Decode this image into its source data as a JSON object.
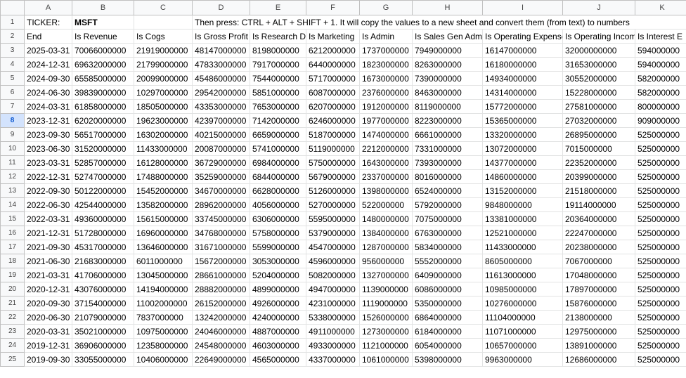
{
  "columns": [
    "A",
    "B",
    "C",
    "D",
    "E",
    "F",
    "G",
    "H",
    "I",
    "J",
    "K"
  ],
  "active_row": "8",
  "row1": {
    "ticker_label": "TICKER:",
    "ticker_value": "MSFT",
    "instruction": "Then press: CTRL + ALT + SHIFT + 1. It will copy the values to a new sheet and convert them (from text) to numbers"
  },
  "headers": [
    "End",
    "Is Revenue",
    "Is Cogs",
    "Is Gross Profit",
    "Is Research De",
    "Is Marketing",
    "Is Admin",
    "Is Sales Gen Admi",
    "Is Operating Expense",
    "Is Operating Incom",
    "Is Interest E"
  ],
  "rows": [
    [
      "3",
      "2025-03-31",
      "70066000000",
      "21919000000",
      "48147000000",
      "8198000000",
      "6212000000",
      "1737000000",
      "7949000000",
      "16147000000",
      "32000000000",
      "594000000"
    ],
    [
      "4",
      "2024-12-31",
      "69632000000",
      "21799000000",
      "47833000000",
      "7917000000",
      "6440000000",
      "1823000000",
      "8263000000",
      "16180000000",
      "31653000000",
      "594000000"
    ],
    [
      "5",
      "2024-09-30",
      "65585000000",
      "20099000000",
      "45486000000",
      "7544000000",
      "5717000000",
      "1673000000",
      "7390000000",
      "14934000000",
      "30552000000",
      "582000000"
    ],
    [
      "6",
      "2024-06-30",
      "39839000000",
      "10297000000",
      "29542000000",
      "5851000000",
      "6087000000",
      "2376000000",
      "8463000000",
      "14314000000",
      "15228000000",
      "582000000"
    ],
    [
      "7",
      "2024-03-31",
      "61858000000",
      "18505000000",
      "43353000000",
      "7653000000",
      "6207000000",
      "1912000000",
      "8119000000",
      "15772000000",
      "27581000000",
      "800000000"
    ],
    [
      "8",
      "2023-12-31",
      "62020000000",
      "19623000000",
      "42397000000",
      "7142000000",
      "6246000000",
      "1977000000",
      "8223000000",
      "15365000000",
      "27032000000",
      "909000000"
    ],
    [
      "9",
      "2023-09-30",
      "56517000000",
      "16302000000",
      "40215000000",
      "6659000000",
      "5187000000",
      "1474000000",
      "6661000000",
      "13320000000",
      "26895000000",
      "525000000"
    ],
    [
      "10",
      "2023-06-30",
      "31520000000",
      "11433000000",
      "20087000000",
      "5741000000",
      "5119000000",
      "2212000000",
      "7331000000",
      "13072000000",
      "7015000000",
      "525000000"
    ],
    [
      "11",
      "2023-03-31",
      "52857000000",
      "16128000000",
      "36729000000",
      "6984000000",
      "5750000000",
      "1643000000",
      "7393000000",
      "14377000000",
      "22352000000",
      "525000000"
    ],
    [
      "12",
      "2022-12-31",
      "52747000000",
      "17488000000",
      "35259000000",
      "6844000000",
      "5679000000",
      "2337000000",
      "8016000000",
      "14860000000",
      "20399000000",
      "525000000"
    ],
    [
      "13",
      "2022-09-30",
      "50122000000",
      "15452000000",
      "34670000000",
      "6628000000",
      "5126000000",
      "1398000000",
      "6524000000",
      "13152000000",
      "21518000000",
      "525000000"
    ],
    [
      "14",
      "2022-06-30",
      "42544000000",
      "13582000000",
      "28962000000",
      "4056000000",
      "5270000000",
      "522000000",
      "5792000000",
      "9848000000",
      "19114000000",
      "525000000"
    ],
    [
      "15",
      "2022-03-31",
      "49360000000",
      "15615000000",
      "33745000000",
      "6306000000",
      "5595000000",
      "1480000000",
      "7075000000",
      "13381000000",
      "20364000000",
      "525000000"
    ],
    [
      "16",
      "2021-12-31",
      "51728000000",
      "16960000000",
      "34768000000",
      "5758000000",
      "5379000000",
      "1384000000",
      "6763000000",
      "12521000000",
      "22247000000",
      "525000000"
    ],
    [
      "17",
      "2021-09-30",
      "45317000000",
      "13646000000",
      "31671000000",
      "5599000000",
      "4547000000",
      "1287000000",
      "5834000000",
      "11433000000",
      "20238000000",
      "525000000"
    ],
    [
      "18",
      "2021-06-30",
      "21683000000",
      "6011000000",
      "15672000000",
      "3053000000",
      "4596000000",
      "956000000",
      "5552000000",
      "8605000000",
      "7067000000",
      "525000000"
    ],
    [
      "19",
      "2021-03-31",
      "41706000000",
      "13045000000",
      "28661000000",
      "5204000000",
      "5082000000",
      "1327000000",
      "6409000000",
      "11613000000",
      "17048000000",
      "525000000"
    ],
    [
      "20",
      "2020-12-31",
      "43076000000",
      "14194000000",
      "28882000000",
      "4899000000",
      "4947000000",
      "1139000000",
      "6086000000",
      "10985000000",
      "17897000000",
      "525000000"
    ],
    [
      "21",
      "2020-09-30",
      "37154000000",
      "11002000000",
      "26152000000",
      "4926000000",
      "4231000000",
      "1119000000",
      "5350000000",
      "10276000000",
      "15876000000",
      "525000000"
    ],
    [
      "22",
      "2020-06-30",
      "21079000000",
      "7837000000",
      "13242000000",
      "4240000000",
      "5338000000",
      "1526000000",
      "6864000000",
      "11104000000",
      "2138000000",
      "525000000"
    ],
    [
      "23",
      "2020-03-31",
      "35021000000",
      "10975000000",
      "24046000000",
      "4887000000",
      "4911000000",
      "1273000000",
      "6184000000",
      "11071000000",
      "12975000000",
      "525000000"
    ],
    [
      "24",
      "2019-12-31",
      "36906000000",
      "12358000000",
      "24548000000",
      "4603000000",
      "4933000000",
      "1121000000",
      "6054000000",
      "10657000000",
      "13891000000",
      "525000000"
    ],
    [
      "25",
      "2019-09-30",
      "33055000000",
      "10406000000",
      "22649000000",
      "4565000000",
      "4337000000",
      "1061000000",
      "5398000000",
      "9963000000",
      "12686000000",
      "525000000"
    ]
  ]
}
